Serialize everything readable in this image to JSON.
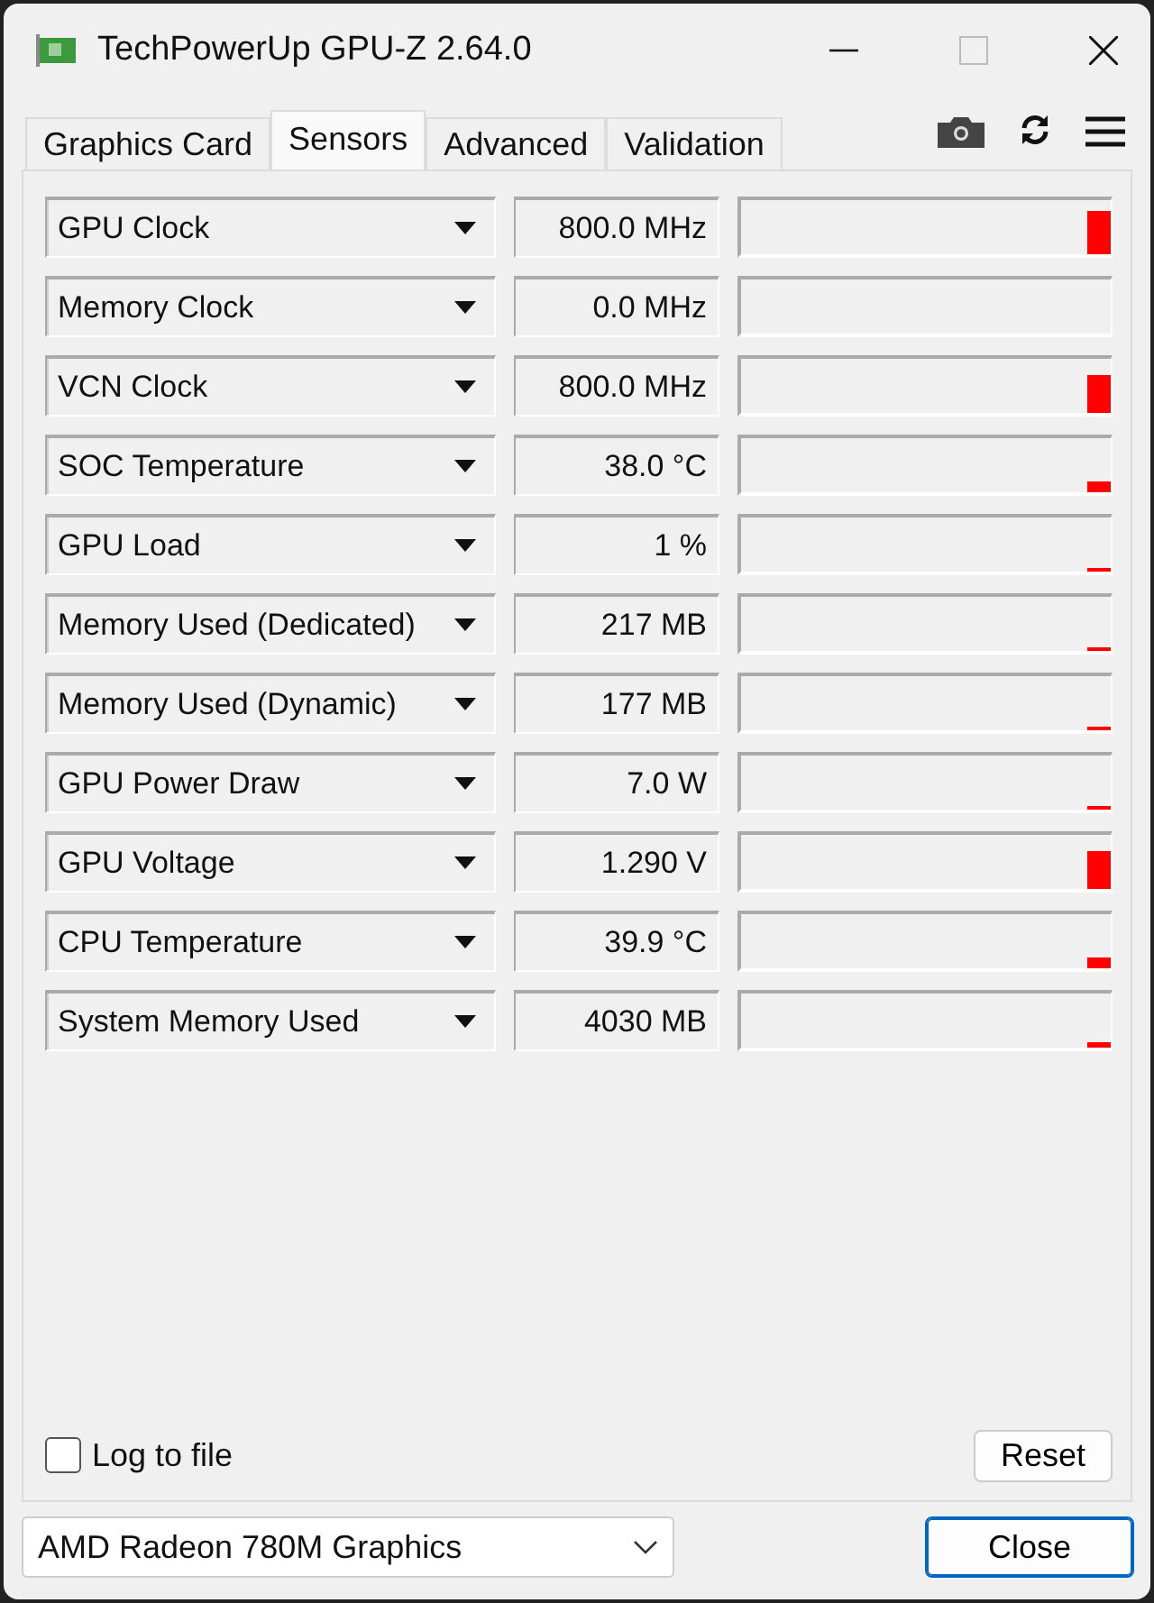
{
  "window": {
    "title": "TechPowerUp GPU-Z 2.64.0"
  },
  "tabs": [
    {
      "label": "Graphics Card",
      "selected": false
    },
    {
      "label": "Sensors",
      "selected": true
    },
    {
      "label": "Advanced",
      "selected": false
    },
    {
      "label": "Validation",
      "selected": false
    }
  ],
  "sensors": [
    {
      "name": "GPU Clock",
      "reading": "800.0 MHz"
    },
    {
      "name": "Memory Clock",
      "reading": "0.0 MHz"
    },
    {
      "name": "VCN Clock",
      "reading": "800.0 MHz"
    },
    {
      "name": "SOC Temperature",
      "reading": "38.0 °C"
    },
    {
      "name": "GPU Load",
      "reading": "1 %"
    },
    {
      "name": "Memory Used (Dedicated)",
      "reading": "217 MB"
    },
    {
      "name": "Memory Used (Dynamic)",
      "reading": "177 MB"
    },
    {
      "name": "GPU Power Draw",
      "reading": "7.0 W"
    },
    {
      "name": "GPU Voltage",
      "reading": "1.290 V"
    },
    {
      "name": "CPU Temperature",
      "reading": "39.9 °C"
    },
    {
      "name": "System Memory Used",
      "reading": "4030 MB"
    }
  ],
  "log_to_file": {
    "label": "Log to file",
    "checked": false
  },
  "reset_button": "Reset",
  "device_select": {
    "value": "AMD Radeon 780M Graphics"
  },
  "close_button": "Close"
}
